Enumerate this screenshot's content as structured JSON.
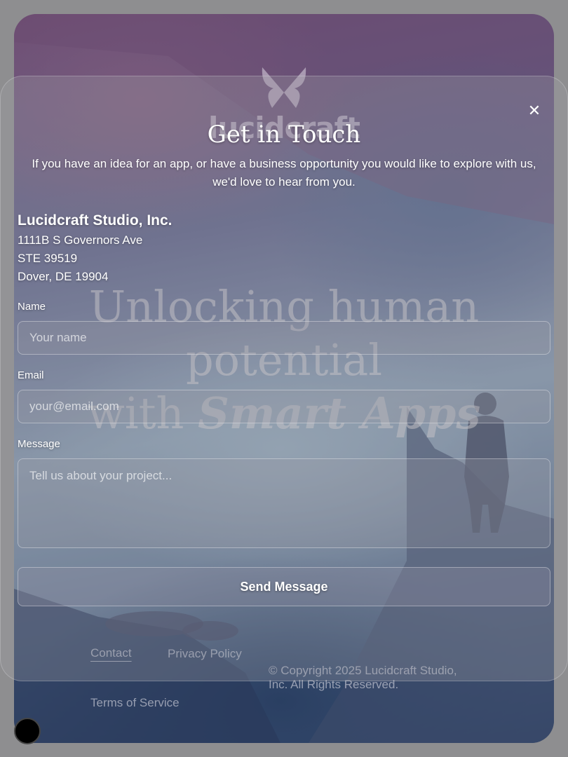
{
  "brand": {
    "wordmark": "lucidcraft",
    "logo_icon": "butterfly-icon"
  },
  "hero": {
    "headline_line1": "Unlocking human",
    "headline_line2": "potential",
    "headline_with": "with",
    "headline_emphasis": "Smart Apps"
  },
  "footer": {
    "contact_link": "Contact",
    "privacy_link": "Privacy Policy",
    "terms_link": "Terms of Service",
    "copyright": "© Copyright 2025 Lucidcraft Studio, Inc. All Rights Reserved."
  },
  "modal": {
    "close_icon": "close-icon",
    "title": "Get in Touch",
    "intro": "If you have an idea for an app, or have a business opportunity you would like to explore with us, we'd love to hear from you.",
    "company": "Lucidcraft Studio, Inc.",
    "address_line1": "1111B S Governors Ave",
    "address_line2": "STE 39519",
    "address_line3": "Dover, DE 19904",
    "form": {
      "name_label": "Name",
      "name_placeholder": "Your name",
      "email_label": "Email",
      "email_placeholder": "your@email.com",
      "message_label": "Message",
      "message_placeholder": "Tell us about your project...",
      "submit_label": "Send Message"
    }
  },
  "colors": {
    "overlay_text": "#ffffff",
    "background": "#8e8e90"
  }
}
